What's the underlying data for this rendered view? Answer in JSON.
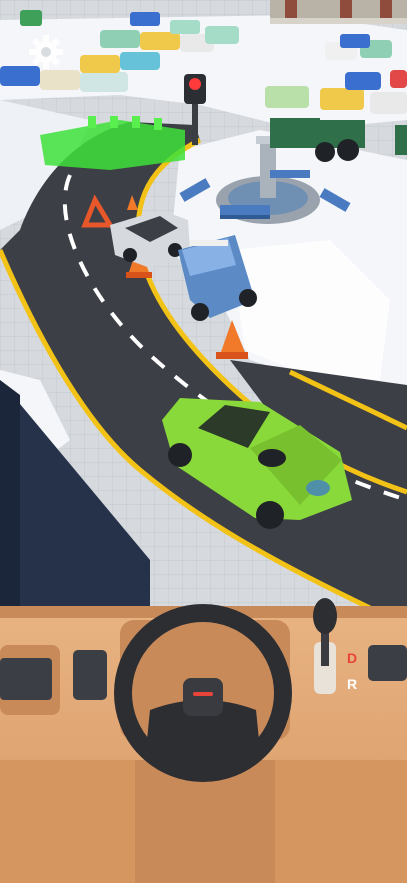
{
  "scene": {
    "player_car_color": "#8ad93a",
    "road_color": "#3c3f45",
    "line_color": "#f2c216",
    "snow_color": "#f4f6fa",
    "parking_target_color": "#3ee03a"
  },
  "controls": {
    "settings_icon": "gear-icon",
    "steering_icon": "steering-wheel-icon",
    "gear_shifter": {
      "drive_label": "D",
      "reverse_label": "R",
      "drive_color": "#e8443a",
      "reverse_color": "#ffffff"
    }
  }
}
